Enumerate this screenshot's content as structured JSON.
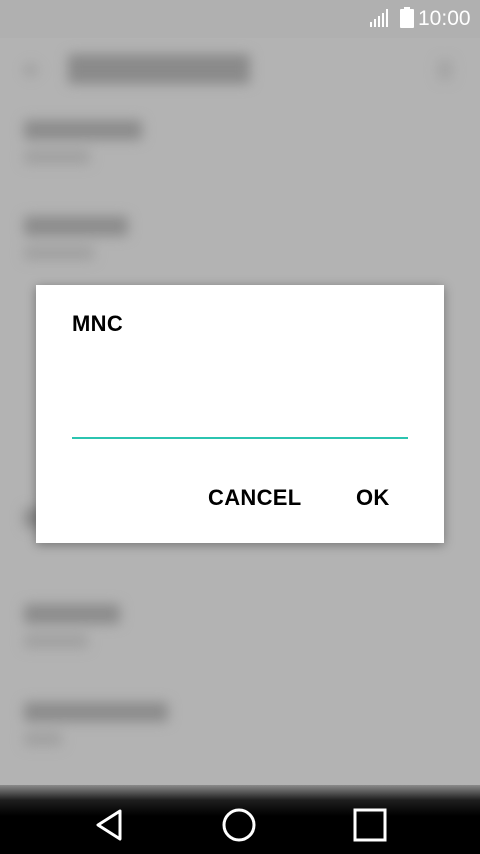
{
  "status_bar": {
    "time": "10:00",
    "signal_icon": "signal-icon",
    "battery_icon": "battery-icon"
  },
  "dialog": {
    "title": "MNC",
    "input_value": "",
    "cancel_label": "CANCEL",
    "ok_label": "OK",
    "accent_color": "#2bc4b0"
  },
  "nav_bar": {
    "back_icon": "back-icon",
    "home_icon": "home-icon",
    "recents_icon": "recents-icon"
  }
}
